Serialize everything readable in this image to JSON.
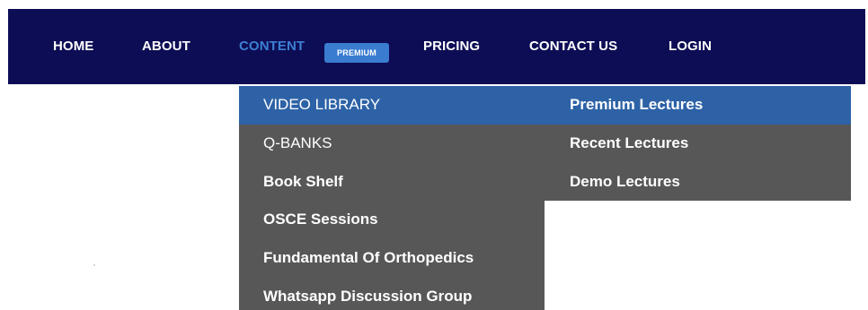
{
  "nav": {
    "items": [
      {
        "label": "HOME"
      },
      {
        "label": "ABOUT"
      },
      {
        "label": "CONTENT"
      },
      {
        "label": "PRICING"
      },
      {
        "label": "CONTACT US"
      },
      {
        "label": "LOGIN"
      }
    ],
    "premium_badge": "PREMIUM"
  },
  "content_menu": {
    "items": [
      {
        "label": "VIDEO LIBRARY"
      },
      {
        "label": "Q-BANKS"
      },
      {
        "label": "Book Shelf"
      },
      {
        "label": "OSCE Sessions"
      },
      {
        "label": "Fundamental Of Orthopedics"
      },
      {
        "label": "Whatsapp Discussion Group"
      }
    ]
  },
  "video_library_menu": {
    "items": [
      {
        "label": "Premium Lectures"
      },
      {
        "label": "Recent Lectures"
      },
      {
        "label": "Demo Lectures"
      }
    ]
  },
  "colors": {
    "navbar_bg": "#0d0d55",
    "active_link": "#3d7fd3",
    "badge_bg": "#3a7cd0",
    "menu_bg": "#575757",
    "menu_highlight": "#2d62a6"
  }
}
